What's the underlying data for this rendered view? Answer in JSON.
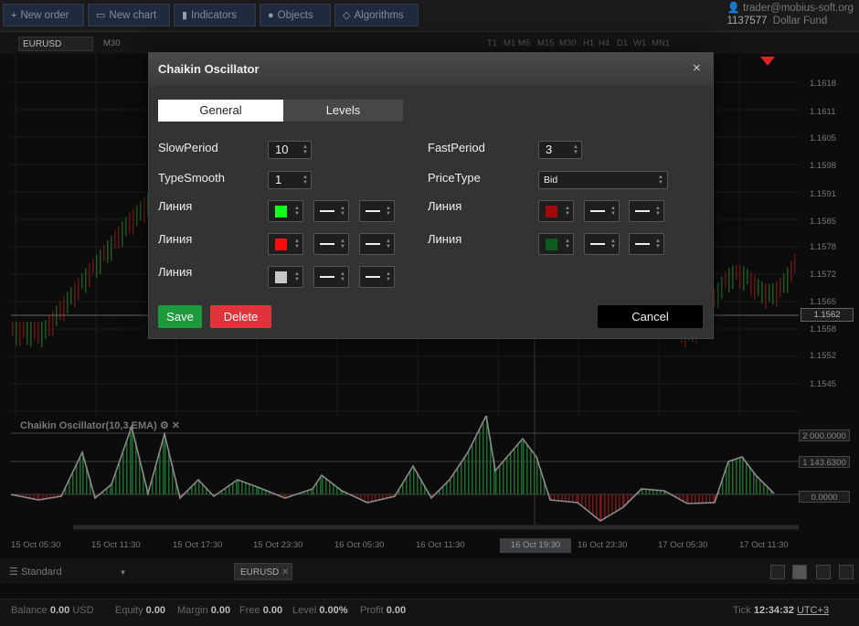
{
  "toolbar": {
    "new_order": "New order",
    "new_chart": "New chart",
    "indicators": "Indicators",
    "objects": "Objects",
    "algorithms": "Algorithms"
  },
  "account": {
    "email": "trader@mobius-soft.org",
    "number": "1137577",
    "fund": "Dollar Fund"
  },
  "chart": {
    "symbol": "EURUSD",
    "timeframe": "M30",
    "timeframes": [
      "T1",
      "M1",
      "M5",
      "M15",
      "M30",
      "H1",
      "H4",
      "D1",
      "W1",
      "MN1"
    ],
    "price_ticks": [
      "1.1618",
      "1.1611",
      "1.1605",
      "1.1598",
      "1.1591",
      "1.1585",
      "1.1578",
      "1.1572",
      "1.1565",
      "1.1558",
      "1.1552",
      "1.1545"
    ],
    "current_price": "1.1562",
    "osc_label": "Chaikin Oscillator(10,3,EMA)",
    "osc_tags": [
      "2 000.0000",
      "1 143.6300",
      "0.0000"
    ],
    "time_ticks": [
      "15 Oct 05:30",
      "15 Oct 11:30",
      "15 Oct 17:30",
      "15 Oct 23:30",
      "16 Oct 05:30",
      "16 Oct 11:30",
      "16 Oct 23:30",
      "17 Oct 05:30",
      "17 Oct 11:30"
    ],
    "time_cursor": "16 Oct 19:30"
  },
  "bottom": {
    "workspace": "Standard",
    "tab": "EURUSD"
  },
  "status": {
    "balance_label": "Balance",
    "balance": "0.00",
    "currency": "USD",
    "equity_label": "Equity",
    "equity": "0.00",
    "margin_label": "Margin",
    "margin": "0.00",
    "free_label": "Free",
    "free": "0.00",
    "level_label": "Level",
    "level": "0.00%",
    "profit_label": "Profit",
    "profit": "0.00",
    "tick_label": "Tick",
    "tick": "12:34:32",
    "tz": "UTC+3"
  },
  "dialog": {
    "title": "Chaikin Oscillator",
    "close": "×",
    "tabs": [
      "General",
      "Levels"
    ],
    "slow_period_label": "SlowPeriod",
    "slow_period": "10",
    "fast_period_label": "FastPeriod",
    "fast_period": "3",
    "type_smooth_label": "TypeSmooth",
    "type_smooth": "1",
    "price_type_label": "PriceType",
    "price_type": "Bid",
    "line_label": "Линия",
    "line_colors_left": [
      "#18ff1e",
      "#ff0a0a",
      "#c8c8c8"
    ],
    "line_colors_right": [
      "#a00a0a",
      "#0f5a1e"
    ],
    "save": "Save",
    "delete": "Delete",
    "cancel": "Cancel"
  }
}
